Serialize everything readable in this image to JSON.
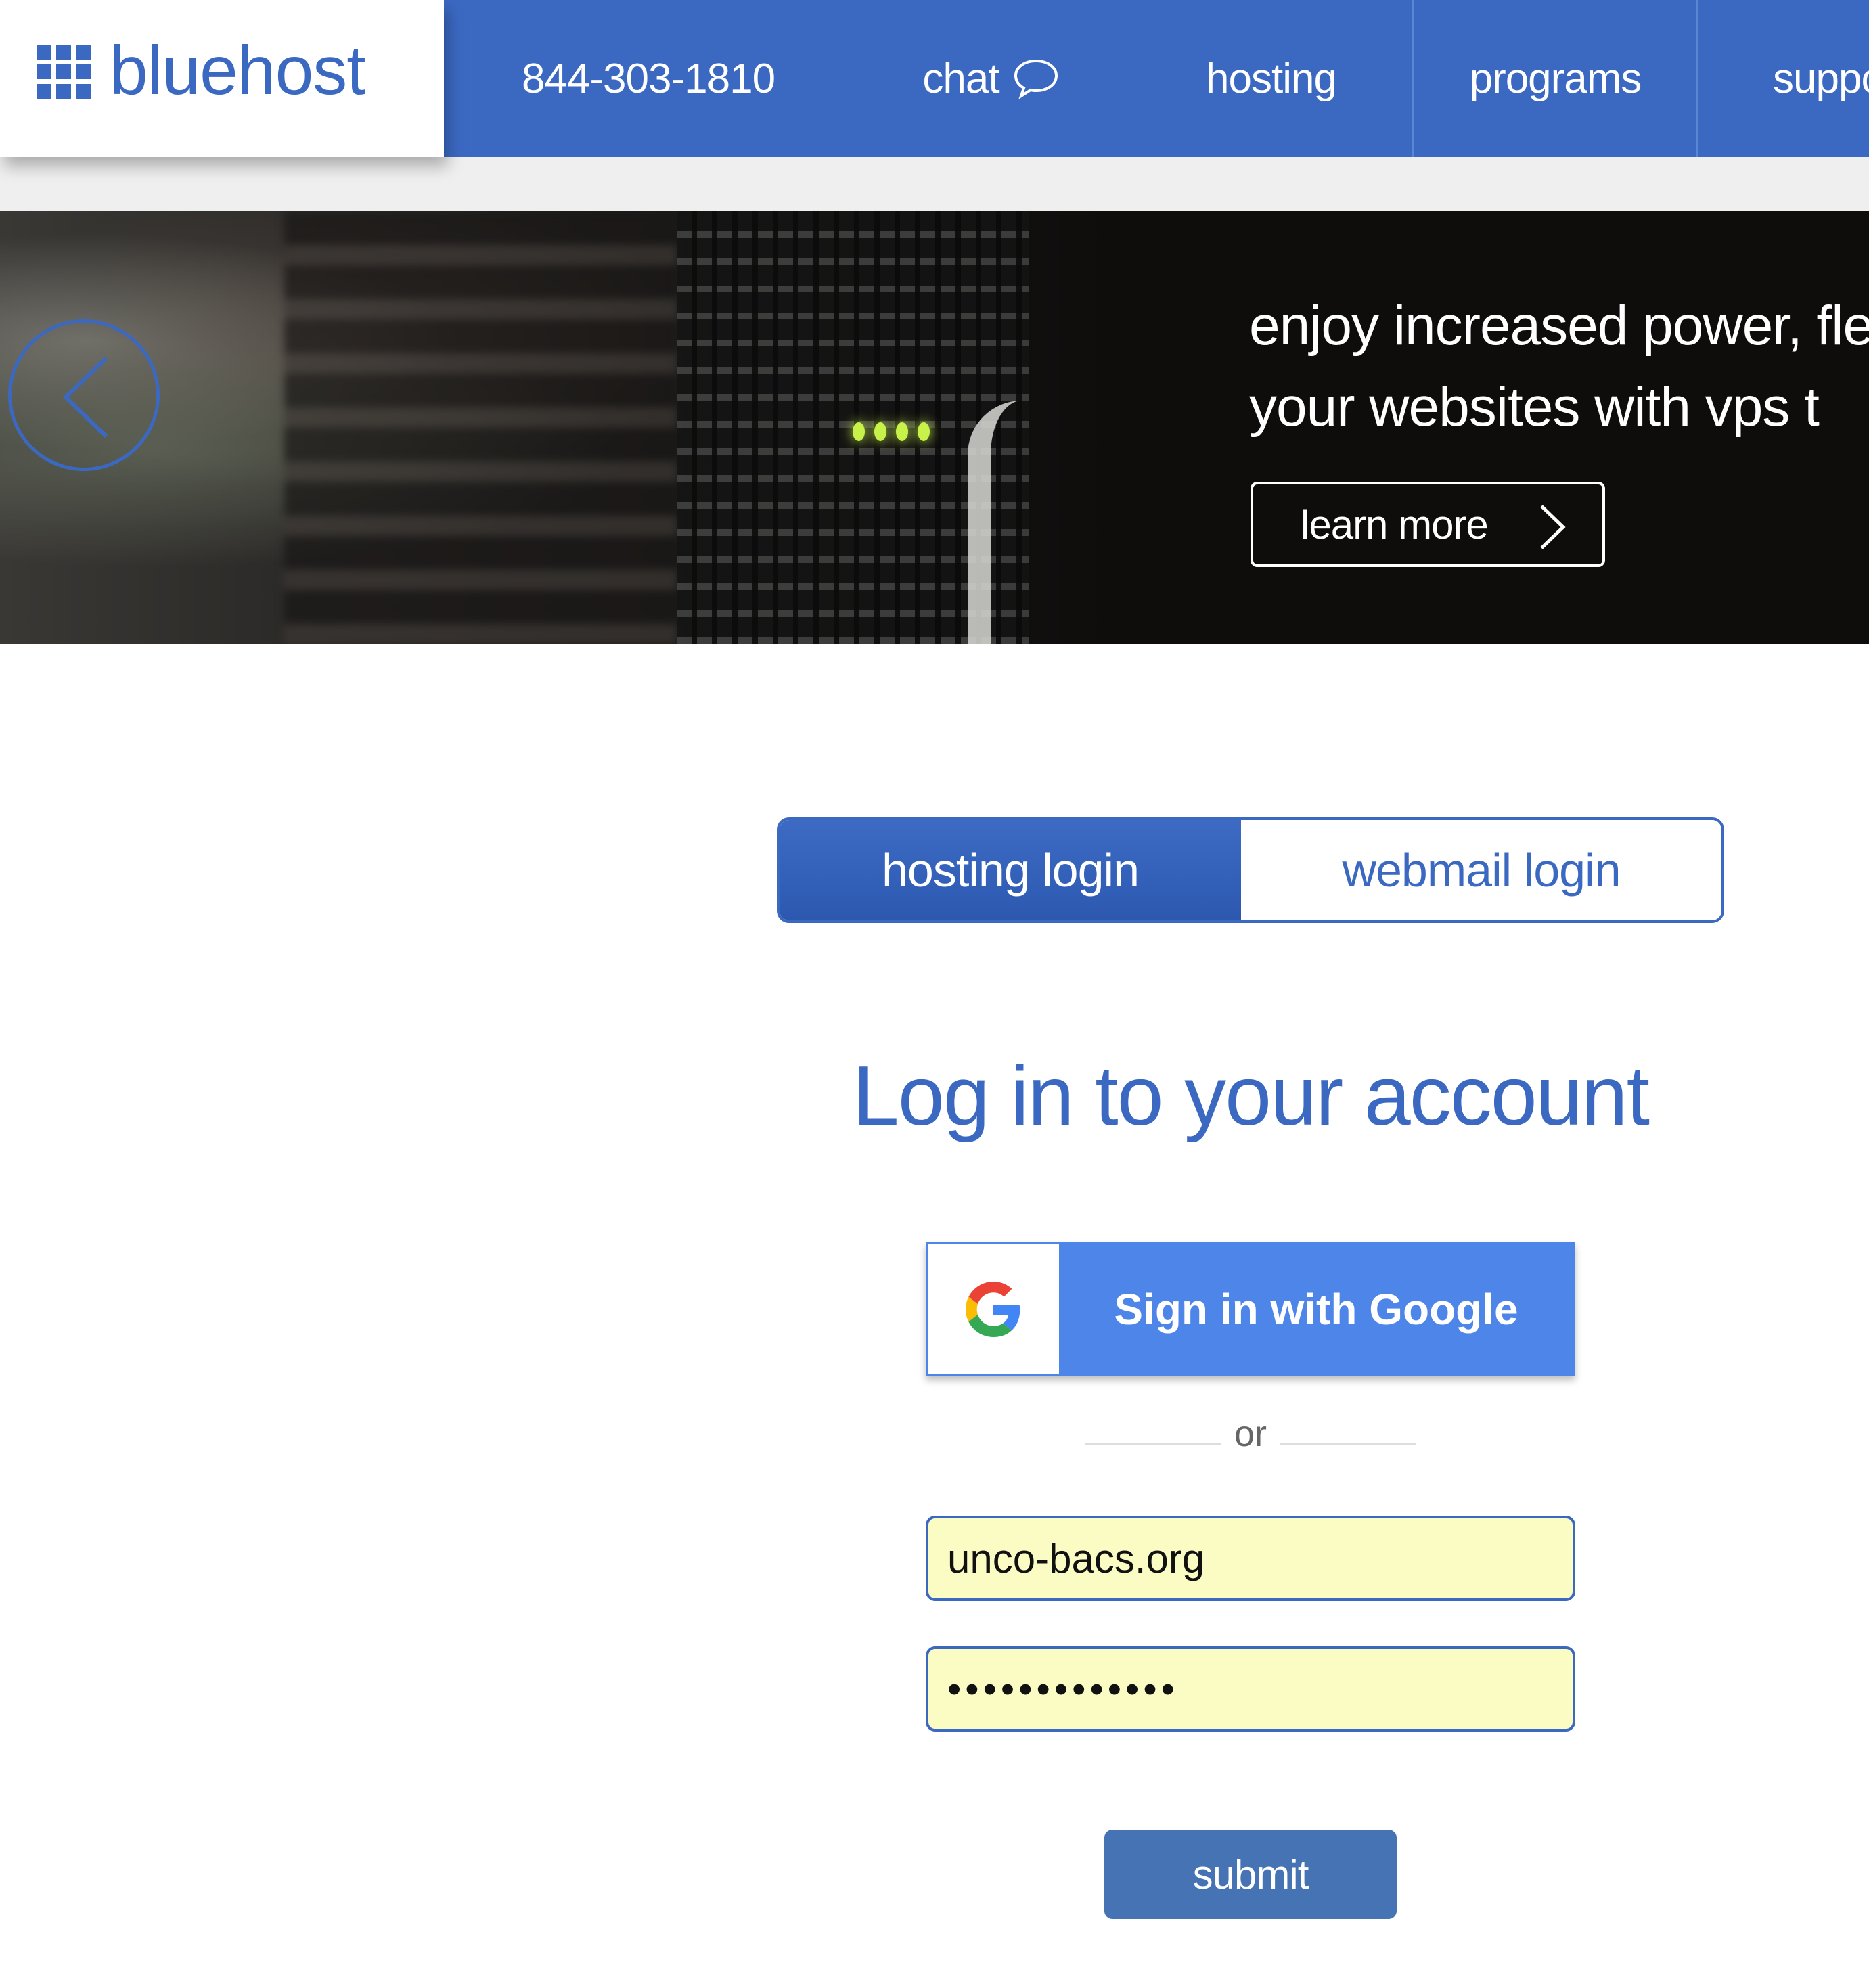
{
  "header": {
    "logo_text": "bluehost",
    "nav": {
      "phone": "844-303-1810",
      "chat": "chat",
      "hosting": "hosting",
      "programs": "programs",
      "support": "suppo"
    }
  },
  "hero": {
    "line1": "enjoy increased power, fle",
    "line2": "your websites with vps t",
    "cta_label": "learn more"
  },
  "login": {
    "tabs": [
      {
        "label": "hosting login",
        "active": true
      },
      {
        "label": "webmail login",
        "active": false
      }
    ],
    "title": "Log in to your account",
    "google_button_label": "Sign in with Google",
    "separator": "or",
    "username_value": "unco-bacs.org",
    "password_value": "•••••••••••••",
    "submit_label": "submit"
  },
  "colors": {
    "brand_blue": "#3b69c2",
    "google_blue": "#4e85e8",
    "autofill_yellow": "#fafcc4",
    "submit_blue": "#4573b4"
  }
}
